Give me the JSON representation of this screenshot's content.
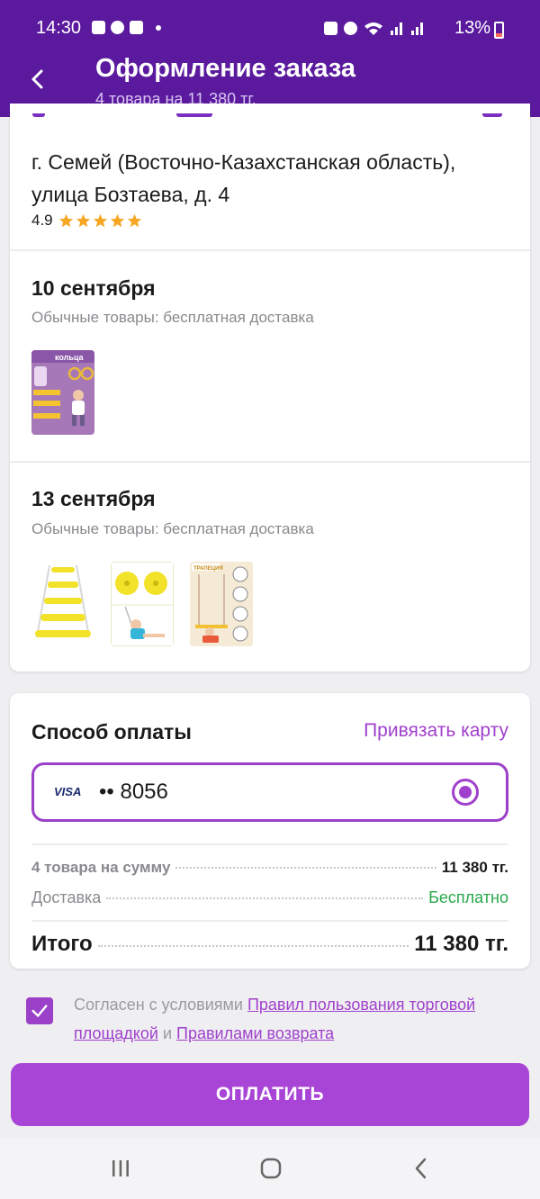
{
  "status_bar": {
    "time": "14:30",
    "battery": "13%"
  },
  "header": {
    "title": "Оформление заказа",
    "subtitle": "4 товара на 11 380 тг."
  },
  "delivery": {
    "address": "г. Семей (Восточно-Казахстанская область), улица Бозтаева, д. 4",
    "rating": "4.9",
    "stars": 5,
    "shipments": [
      {
        "date": "10 сентября",
        "note": "Обычные товары: бесплатная доставка"
      },
      {
        "date": "13 сентября",
        "note": "Обычные товары: бесплатная доставка"
      }
    ],
    "thumb_texts": {
      "rings": "кольца",
      "trapeze": "ТРАПЕЦИЯ"
    }
  },
  "payment": {
    "title": "Способ оплаты",
    "link_card": "Привязать карту",
    "card_brand": "VISA",
    "card_number": "•• 8056",
    "summary": {
      "items_label": "4 товара на сумму",
      "items_value": "11 380 тг.",
      "delivery_label": "Доставка",
      "delivery_value": "Бесплатно",
      "total_label": "Итого",
      "total_value": "11 380 тг."
    }
  },
  "agreement": {
    "prefix": "Согласен с условиями ",
    "link1": "Правил пользования торговой площадкой",
    "mid": " и ",
    "link2": "Правилами возврата",
    "checked": true
  },
  "pay_button": "ОПЛАТИТЬ",
  "colors": {
    "brand": "#5b1a9e",
    "accent": "#a845d6",
    "success": "#2aa84a",
    "star": "#f5a623"
  }
}
